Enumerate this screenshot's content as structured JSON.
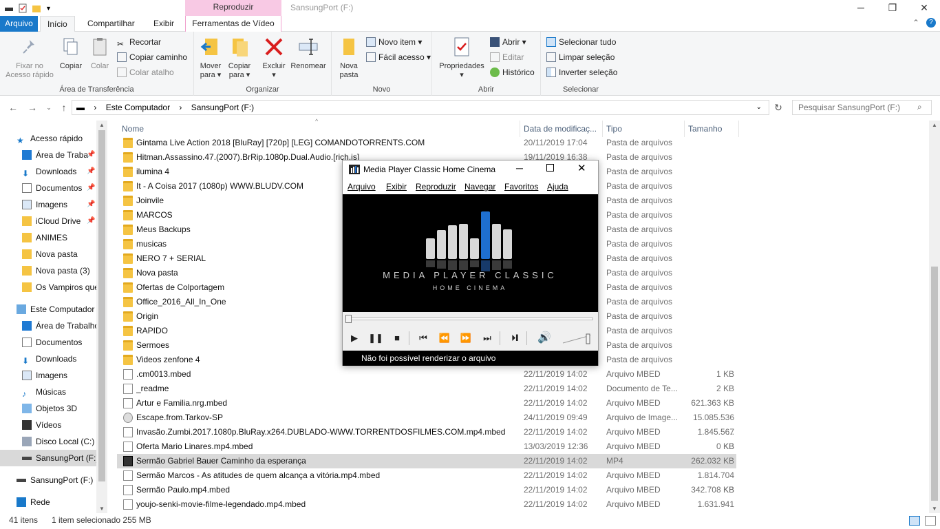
{
  "titlebar": {
    "ctx_tab": "Reproduzir",
    "window_title": "SansungPort (F:)",
    "min": "─",
    "max": "❐",
    "close": "✕"
  },
  "tabs": {
    "file": "Arquivo",
    "home": "Início",
    "share": "Compartilhar",
    "view": "Exibir",
    "video_tools": "Ferramentas de Vídeo"
  },
  "ribbon": {
    "pin": "Fixar no\nAcesso rápido",
    "copy": "Copiar",
    "paste": "Colar",
    "cut": "Recortar",
    "copy_path": "Copiar caminho",
    "paste_shortcut": "Colar atalho",
    "clipboard_group": "Área de Transferência",
    "move_to": "Mover\npara ▾",
    "copy_to": "Copiar\npara ▾",
    "delete": "Excluir\n▾",
    "rename": "Renomear",
    "organize_group": "Organizar",
    "new_folder": "Nova\npasta",
    "new_item": "Novo item ▾",
    "easy_access": "Fácil acesso ▾",
    "new_group": "Novo",
    "properties": "Propriedades\n▾",
    "open": "Abrir ▾",
    "edit": "Editar",
    "history": "Histórico",
    "open_group": "Abrir",
    "select_all": "Selecionar tudo",
    "select_none": "Limpar seleção",
    "invert": "Inverter seleção",
    "select_group": "Selecionar"
  },
  "address": {
    "crumbs": [
      "Este Computador",
      "SansungPort (F:)"
    ],
    "search_placeholder": "Pesquisar SansungPort (F:)"
  },
  "nav": [
    {
      "label": "Acesso rápido",
      "icon": "star-icon",
      "indent": 24,
      "pin": false
    },
    {
      "label": "Área de Traba",
      "icon": "desktop-icon",
      "indent": 32,
      "pin": true
    },
    {
      "label": "Downloads",
      "icon": "download-icon",
      "indent": 32,
      "pin": true
    },
    {
      "label": "Documentos",
      "icon": "document-icon",
      "indent": 32,
      "pin": true
    },
    {
      "label": "Imagens",
      "icon": "image-icon",
      "indent": 32,
      "pin": true
    },
    {
      "label": "iCloud Drive",
      "icon": "folder-icon",
      "indent": 32,
      "pin": true
    },
    {
      "label": "ANIMES",
      "icon": "folder-icon",
      "indent": 32,
      "pin": false
    },
    {
      "label": "Nova pasta",
      "icon": "folder-icon",
      "indent": 32,
      "pin": false
    },
    {
      "label": "Nova pasta (3)",
      "icon": "folder-icon",
      "indent": 32,
      "pin": false
    },
    {
      "label": "Os Vampiros que",
      "icon": "folder-icon",
      "indent": 32,
      "pin": false
    },
    {
      "label": "Este Computador",
      "icon": "computer-icon",
      "indent": 24,
      "pin": false
    },
    {
      "label": "Área de Trabalho",
      "icon": "desktop-icon",
      "indent": 32,
      "pin": false
    },
    {
      "label": "Documentos",
      "icon": "document-icon",
      "indent": 32,
      "pin": false
    },
    {
      "label": "Downloads",
      "icon": "download-icon",
      "indent": 32,
      "pin": false
    },
    {
      "label": "Imagens",
      "icon": "image-icon",
      "indent": 32,
      "pin": false
    },
    {
      "label": "Músicas",
      "icon": "music-icon",
      "indent": 32,
      "pin": false
    },
    {
      "label": "Objetos 3D",
      "icon": "cube-icon",
      "indent": 32,
      "pin": false
    },
    {
      "label": "Vídeos",
      "icon": "video-icon",
      "indent": 32,
      "pin": false
    },
    {
      "label": "Disco Local (C:)",
      "icon": "disk-icon",
      "indent": 32,
      "pin": false
    },
    {
      "label": "SansungPort (F:)",
      "icon": "drive-icon",
      "indent": 32,
      "pin": false,
      "selected": true
    },
    {
      "label": "SansungPort (F:)",
      "icon": "drive-icon",
      "indent": 24,
      "pin": false
    },
    {
      "label": "Rede",
      "icon": "network-icon",
      "indent": 24,
      "pin": false
    }
  ],
  "columns": {
    "name": "Nome",
    "date": "Data de modificaç...",
    "type": "Tipo",
    "size": "Tamanho"
  },
  "files": [
    {
      "name": "Gintama Live Action 2018 [BluRay] [720p] [LEG] COMANDOTORRENTS.COM",
      "date": "20/11/2019 17:04",
      "type": "Pasta de arquivos",
      "size": "",
      "kind": "folder"
    },
    {
      "name": "Hitman.Assassino.47.(2007).BrRip.1080p.Dual.Audio.[rich.js]",
      "date": "19/11/2019 16:38",
      "type": "Pasta de arquivos",
      "size": "",
      "kind": "folder"
    },
    {
      "name": "ilumina 4",
      "date": "",
      "type": "Pasta de arquivos",
      "size": "",
      "kind": "folder"
    },
    {
      "name": "It - A Coisa 2017 (1080p) WWW.BLUDV.COM",
      "date": "",
      "type": "Pasta de arquivos",
      "size": "",
      "kind": "folder"
    },
    {
      "name": "Joinvile",
      "date": "",
      "type": "Pasta de arquivos",
      "size": "",
      "kind": "folder"
    },
    {
      "name": "MARCOS",
      "date": "",
      "type": "Pasta de arquivos",
      "size": "",
      "kind": "folder"
    },
    {
      "name": "Meus Backups",
      "date": "",
      "type": "Pasta de arquivos",
      "size": "",
      "kind": "folder"
    },
    {
      "name": "musicas",
      "date": "",
      "type": "Pasta de arquivos",
      "size": "",
      "kind": "folder"
    },
    {
      "name": "NERO 7 + SERIAL",
      "date": "",
      "type": "Pasta de arquivos",
      "size": "",
      "kind": "folder"
    },
    {
      "name": "Nova pasta",
      "date": "",
      "type": "Pasta de arquivos",
      "size": "",
      "kind": "folder"
    },
    {
      "name": "Ofertas de Colportagem",
      "date": "",
      "type": "Pasta de arquivos",
      "size": "",
      "kind": "folder"
    },
    {
      "name": "Office_2016_All_In_One",
      "date": "",
      "type": "Pasta de arquivos",
      "size": "",
      "kind": "folder"
    },
    {
      "name": "Origin",
      "date": "",
      "type": "Pasta de arquivos",
      "size": "",
      "kind": "folder"
    },
    {
      "name": "RAPIDO",
      "date": "",
      "type": "Pasta de arquivos",
      "size": "",
      "kind": "folder"
    },
    {
      "name": "Sermoes",
      "date": "",
      "type": "Pasta de arquivos",
      "size": "",
      "kind": "folder"
    },
    {
      "name": "Videos zenfone 4",
      "date": "",
      "type": "Pasta de arquivos",
      "size": "",
      "kind": "folder"
    },
    {
      "name": ".cm0013.mbed",
      "date": "22/11/2019 14:02",
      "type": "Arquivo MBED",
      "size": "1 KB",
      "kind": "doc"
    },
    {
      "name": "_readme",
      "date": "22/11/2019 14:02",
      "type": "Documento de Te...",
      "size": "2 KB",
      "kind": "doc"
    },
    {
      "name": "Artur e Familia.nrg.mbed",
      "date": "22/11/2019 14:02",
      "type": "Arquivo MBED",
      "size": "621.363 KB",
      "kind": "doc"
    },
    {
      "name": "Escape.from.Tarkov-SP",
      "date": "24/11/2019 09:49",
      "type": "Arquivo de Image...",
      "size": "15.085.536 ...",
      "kind": "disc"
    },
    {
      "name": "Invasão.Zumbi.2017.1080p.BluRay.x264.DUBLADO-WWW.TORRENTDOSFILMES.COM.mp4.mbed",
      "date": "22/11/2019 14:02",
      "type": "Arquivo MBED",
      "size": "1.845.567 KB",
      "kind": "doc"
    },
    {
      "name": "Oferta Mario Linares.mp4.mbed",
      "date": "13/03/2019 12:36",
      "type": "Arquivo MBED",
      "size": "0 KB",
      "kind": "doc"
    },
    {
      "name": "Sermão Gabriel Bauer Caminho da esperança",
      "date": "22/11/2019 14:02",
      "type": "MP4",
      "size": "262.032 KB",
      "kind": "mp4",
      "selected": true
    },
    {
      "name": "Sermão Marcos - As atitudes de quem alcança a vitória.mp4.mbed",
      "date": "22/11/2019 14:02",
      "type": "Arquivo MBED",
      "size": "1.814.704 KB",
      "kind": "doc"
    },
    {
      "name": "Sermão Paulo.mp4.mbed",
      "date": "22/11/2019 14:02",
      "type": "Arquivo MBED",
      "size": "342.708 KB",
      "kind": "doc"
    },
    {
      "name": "youjo-senki-movie-filme-legendado.mp4.mbed",
      "date": "22/11/2019 14:02",
      "type": "Arquivo MBED",
      "size": "1.631.941 KB",
      "kind": "doc"
    }
  ],
  "status": {
    "count": "41 itens",
    "selection": "1 item selecionado  255 MB"
  },
  "mpc": {
    "title": "Media Player Classic Home Cinema",
    "menu": [
      "Arquivo",
      "Exibir",
      "Reproduzir",
      "Navegar",
      "Favoritos",
      "Ajuda"
    ],
    "logo_main": "MEDIA PLAYER CLASSIC",
    "logo_sub": "HOME CINEMA",
    "status": "Não foi possível renderizar o arquivo",
    "accent": "#1e6fd0"
  }
}
